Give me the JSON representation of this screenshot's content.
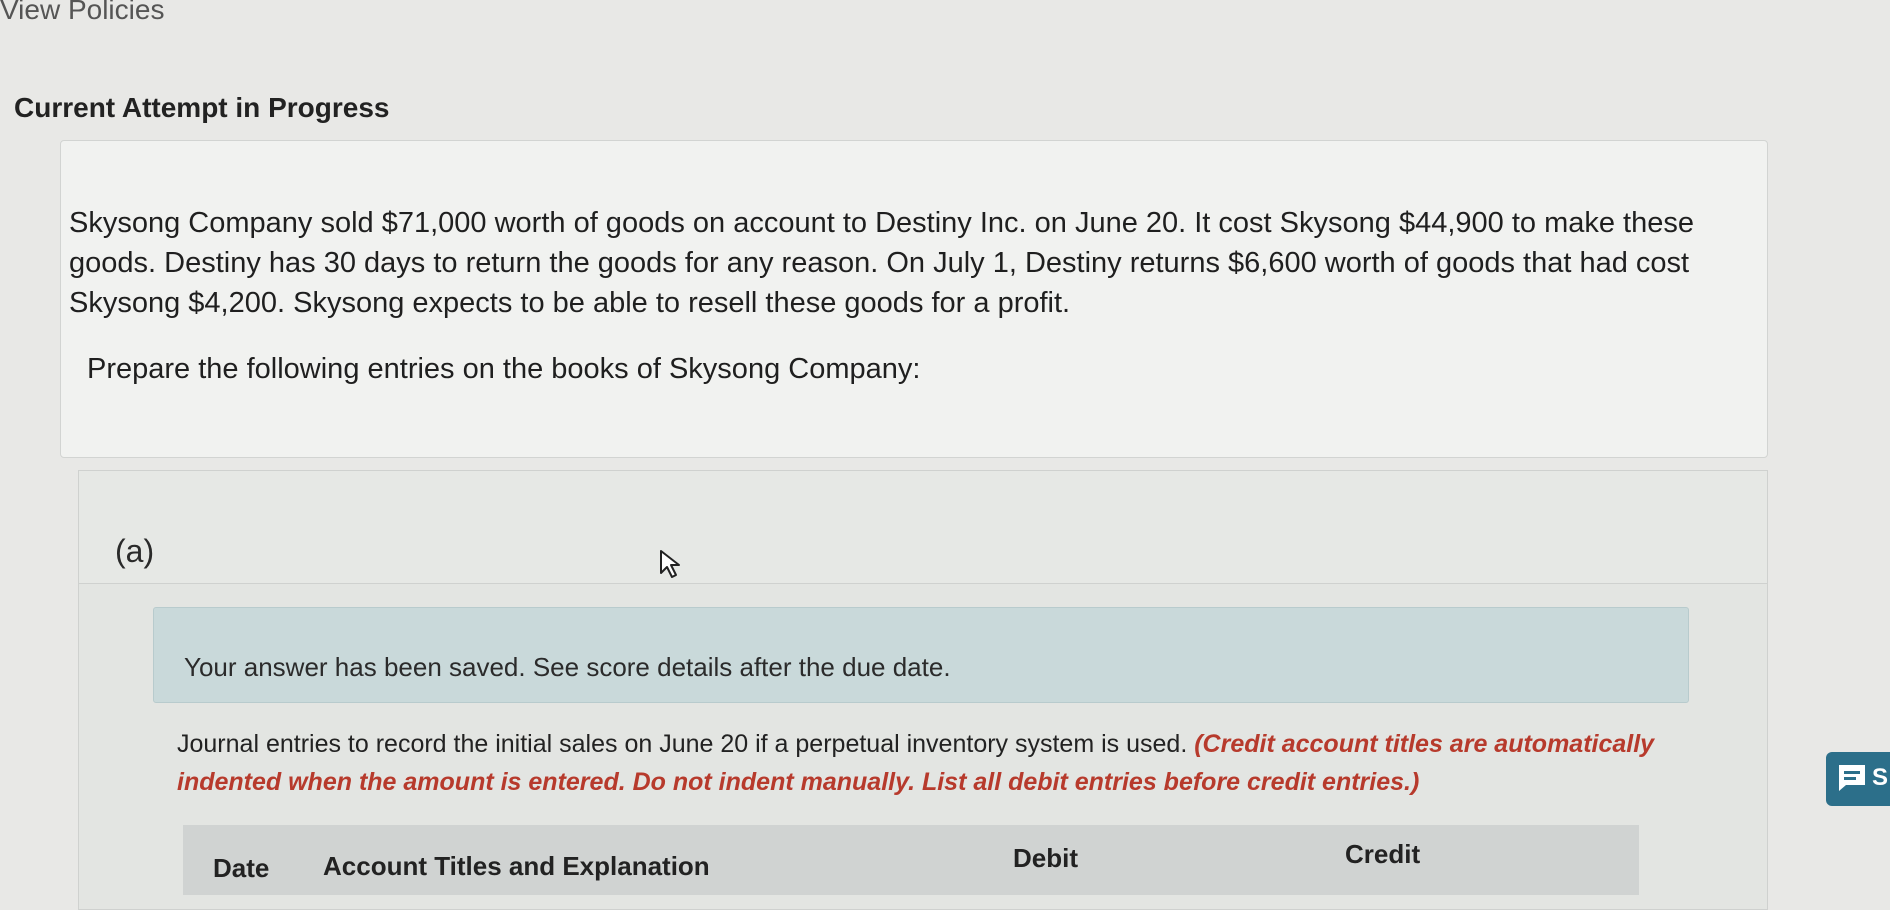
{
  "header": {
    "view_policies": "View Policies",
    "attempt_title": "Current Attempt in Progress"
  },
  "problem": {
    "text": "Skysong Company sold $71,000 worth of goods on account to Destiny Inc. on June 20. It cost Skysong $44,900 to make these goods. Destiny has 30 days to return the goods for any reason. On July 1, Destiny returns $6,600 worth of goods that had cost Skysong $4,200. Skysong expects to be able to resell these goods for a profit.",
    "prepare": "Prepare the following entries on the books of Skysong Company:"
  },
  "part": {
    "label": "(a)",
    "saved_message": "Your answer has been saved. See score details after the due date.",
    "instruction_main": "Journal entries to record the initial sales on June 20 if a perpetual inventory system is used. ",
    "instruction_note": "(Credit account titles are automatically indented when the amount is entered. Do not indent manually. List all debit entries before credit entries.)"
  },
  "table": {
    "headers": {
      "date": "Date",
      "account": "Account Titles and Explanation",
      "debit": "Debit",
      "credit": "Credit"
    }
  },
  "chat": {
    "letter": "S",
    "icon": "chat-icon",
    "color": "#2c6f8a"
  }
}
